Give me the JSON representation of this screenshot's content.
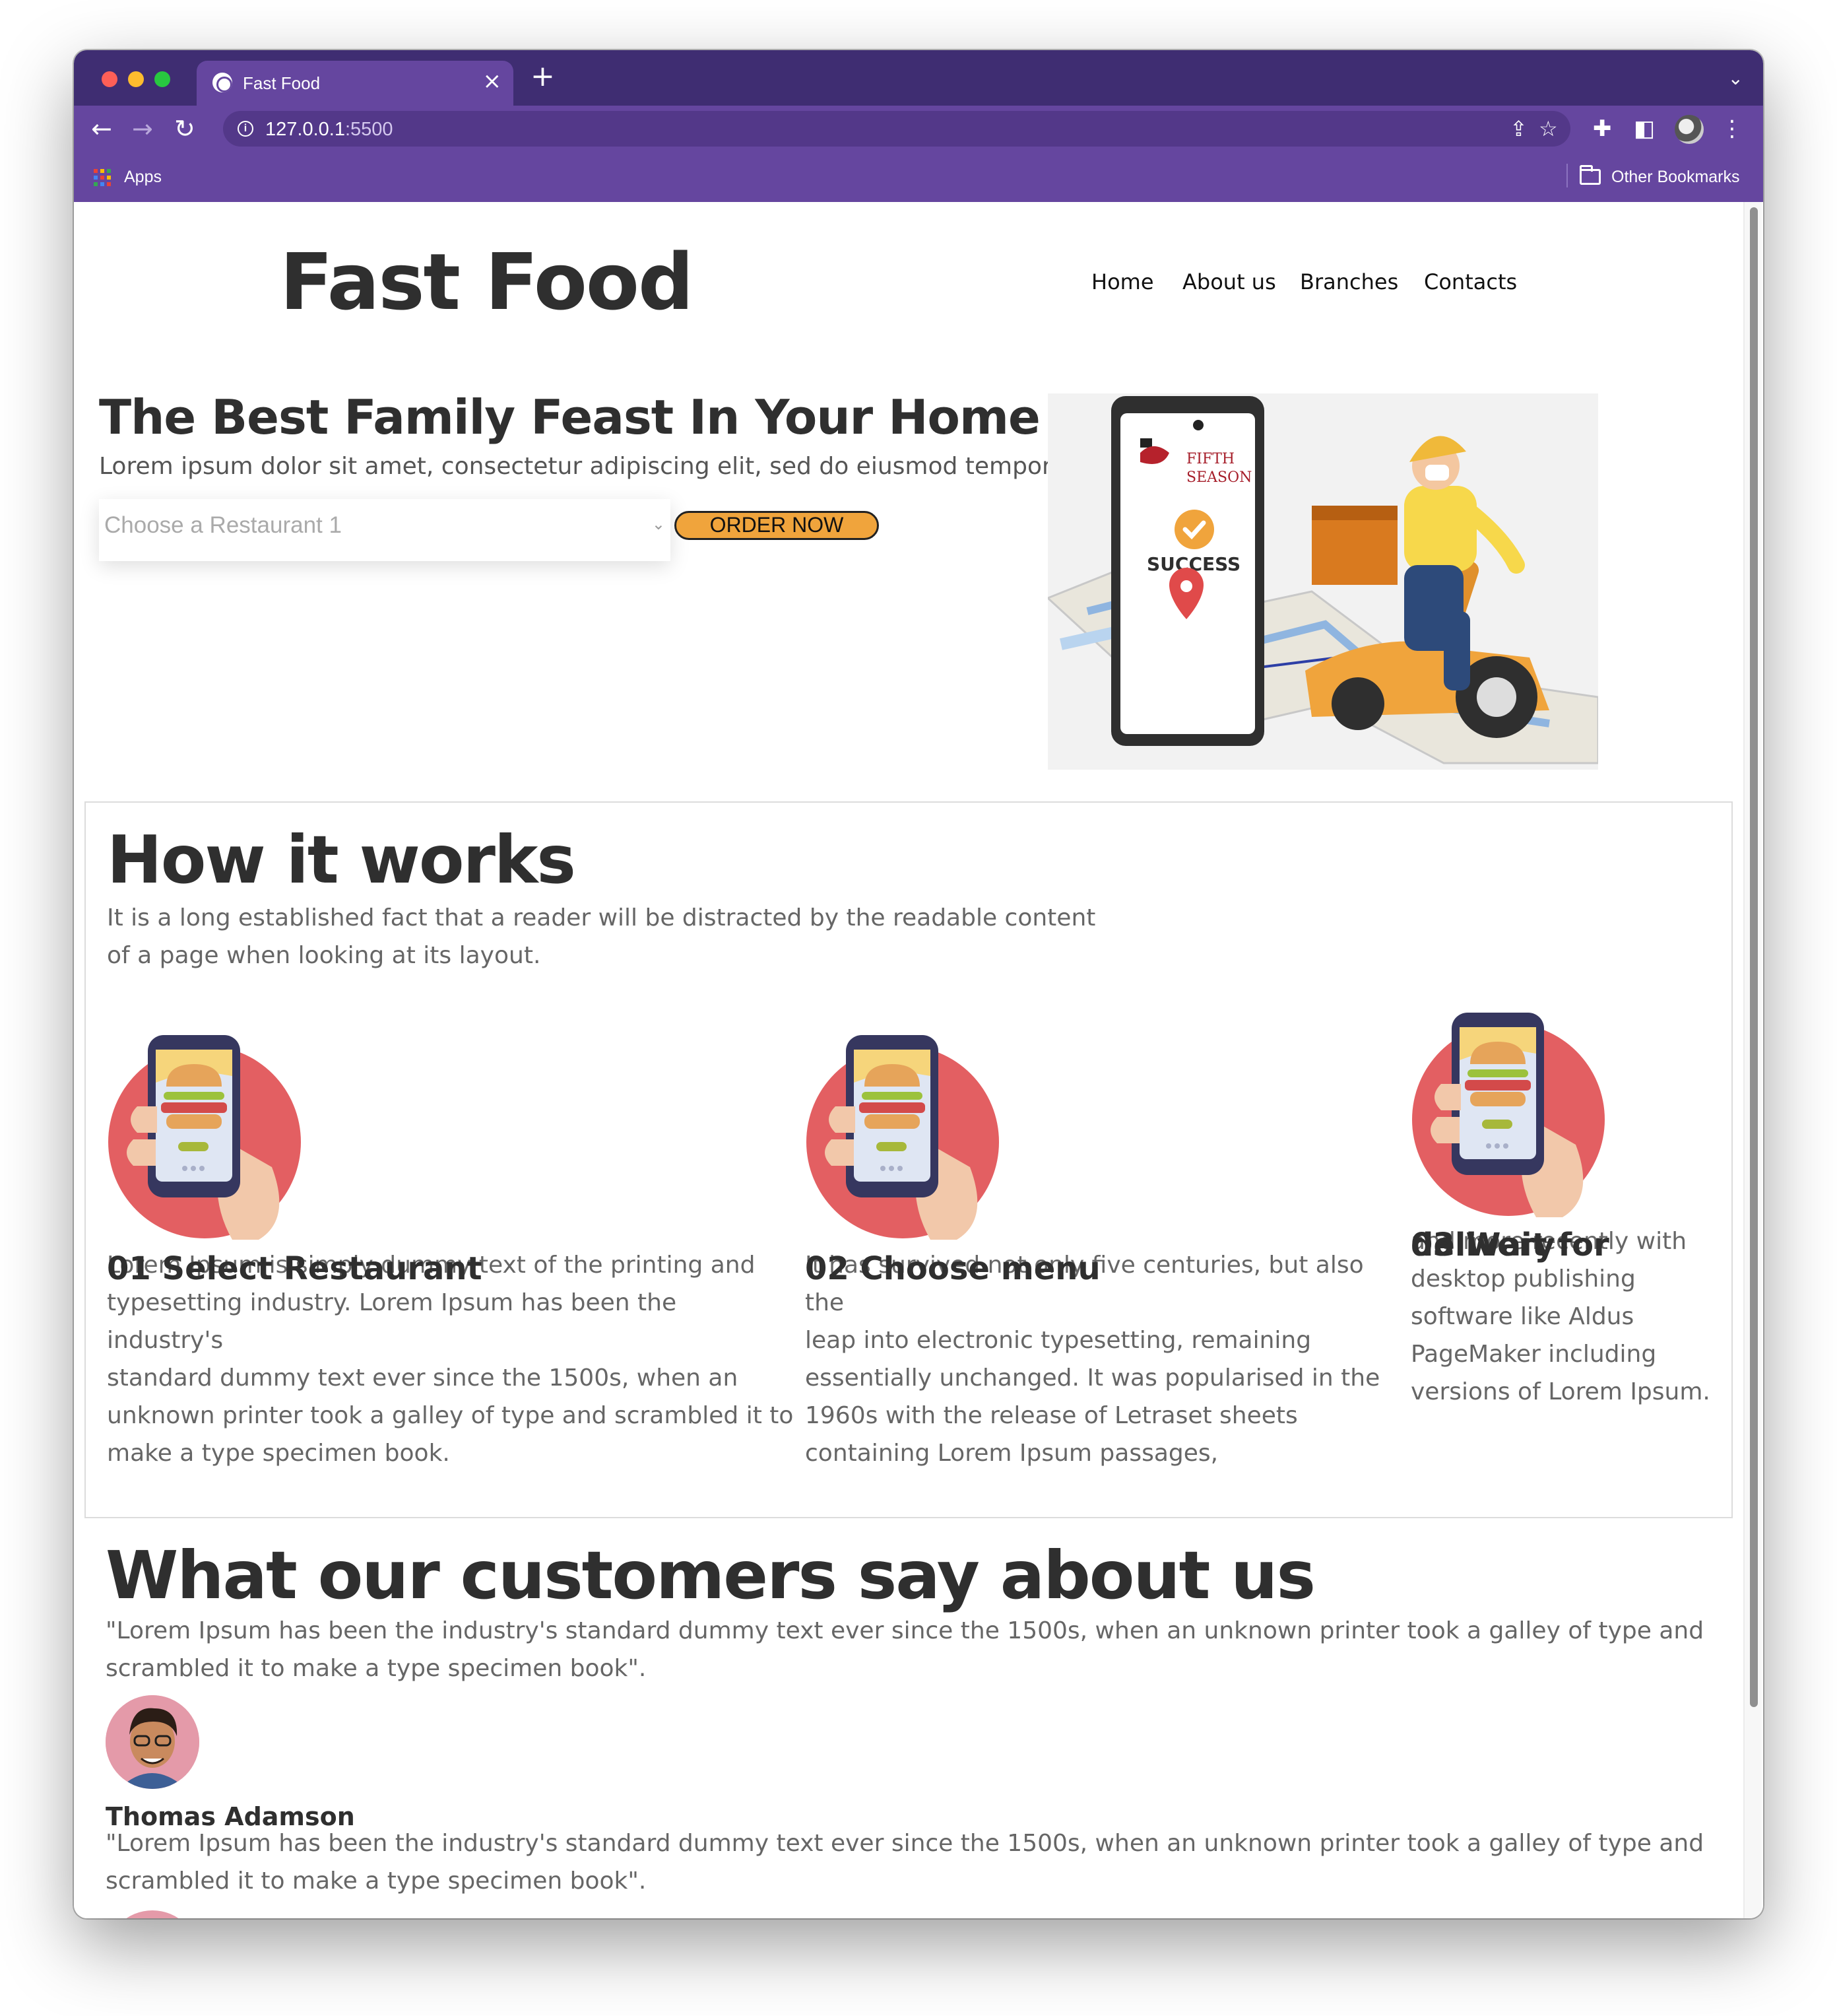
{
  "browser": {
    "tab_title": "Fast Food",
    "tab_close": "×",
    "new_tab": "+",
    "tab_dropdown": "⌄",
    "url_host": "127.0.0.1",
    "url_port": ":5500",
    "info_icon": "i",
    "back": "←",
    "forward": "→",
    "reload": "↻",
    "share": "⇪",
    "star": "☆",
    "extensions": "✚",
    "sidepanel": "◧",
    "menu": "⋮",
    "apps_label": "Apps",
    "other_bookmarks_label": "Other Bookmarks",
    "colors": {
      "tabbar": "#3f2d72",
      "toolbar": "#65469f",
      "omnibox": "#533889"
    }
  },
  "site": {
    "logo": "Fast Food",
    "nav": [
      "Home",
      "About us",
      "Branches",
      "Contacts"
    ],
    "accent_color": "#f0a43c"
  },
  "hero": {
    "title": "The Best Family Feast In Your Home",
    "subtitle": "Lorem ipsum dolor sit amet, consectetur adipiscing elit, sed do eiusmod tempor.",
    "select_value": "Choose a Restaurant 1",
    "select_chevron": "⌄",
    "order_button": "ORDER NOW",
    "illustration": {
      "restaurant_brand_line1": "FIFTH",
      "restaurant_brand_line2": "SEASON",
      "success_label": "SUCCESS"
    }
  },
  "how": {
    "title": "How it works",
    "intro_line1": "It is a long established fact that a reader will be distracted by the readable content",
    "intro_line2": "of a page when looking at its layout.",
    "steps": [
      {
        "title_lines": [
          "01 Select Restaurant"
        ],
        "text_lines": [
          "Lorem Ipsum is simply dummy text of the printing and",
          "typesetting industry. Lorem Ipsum has been the industry's",
          "standard dummy text ever since the 1500s, when an",
          "unknown printer took a galley of type and scrambled it to",
          "make a type specimen book."
        ]
      },
      {
        "title_lines": [
          "02 Choose menu"
        ],
        "text_lines": [
          "It has survived not only five centuries, but also the",
          "leap into electronic typesetting, remaining",
          "essentially unchanged. It was popularised in the",
          "1960s with the release of Letraset sheets",
          "containing Lorem Ipsum passages,"
        ]
      },
      {
        "title_lines": [
          "03 Wait for",
          "delivery"
        ],
        "text_lines": [
          "and more recently with",
          "desktop publishing",
          "software like Aldus",
          "PageMaker including",
          "versions of Lorem Ipsum."
        ]
      }
    ]
  },
  "testimonials": {
    "title": "What our customers say about us",
    "quote1_line1": "\"Lorem Ipsum has been the industry's standard dummy text ever since the 1500s, when an unknown printer took a galley of type and",
    "quote1_line2": "scrambled it to make a type specimen book\".",
    "reviewer_name": "Thomas Adamson",
    "quote2_line1": "\"Lorem Ipsum has been the industry's standard dummy text ever since the 1500s, when an unknown printer took a galley of type and",
    "quote2_line2": "scrambled it to make a type specimen book\"."
  }
}
